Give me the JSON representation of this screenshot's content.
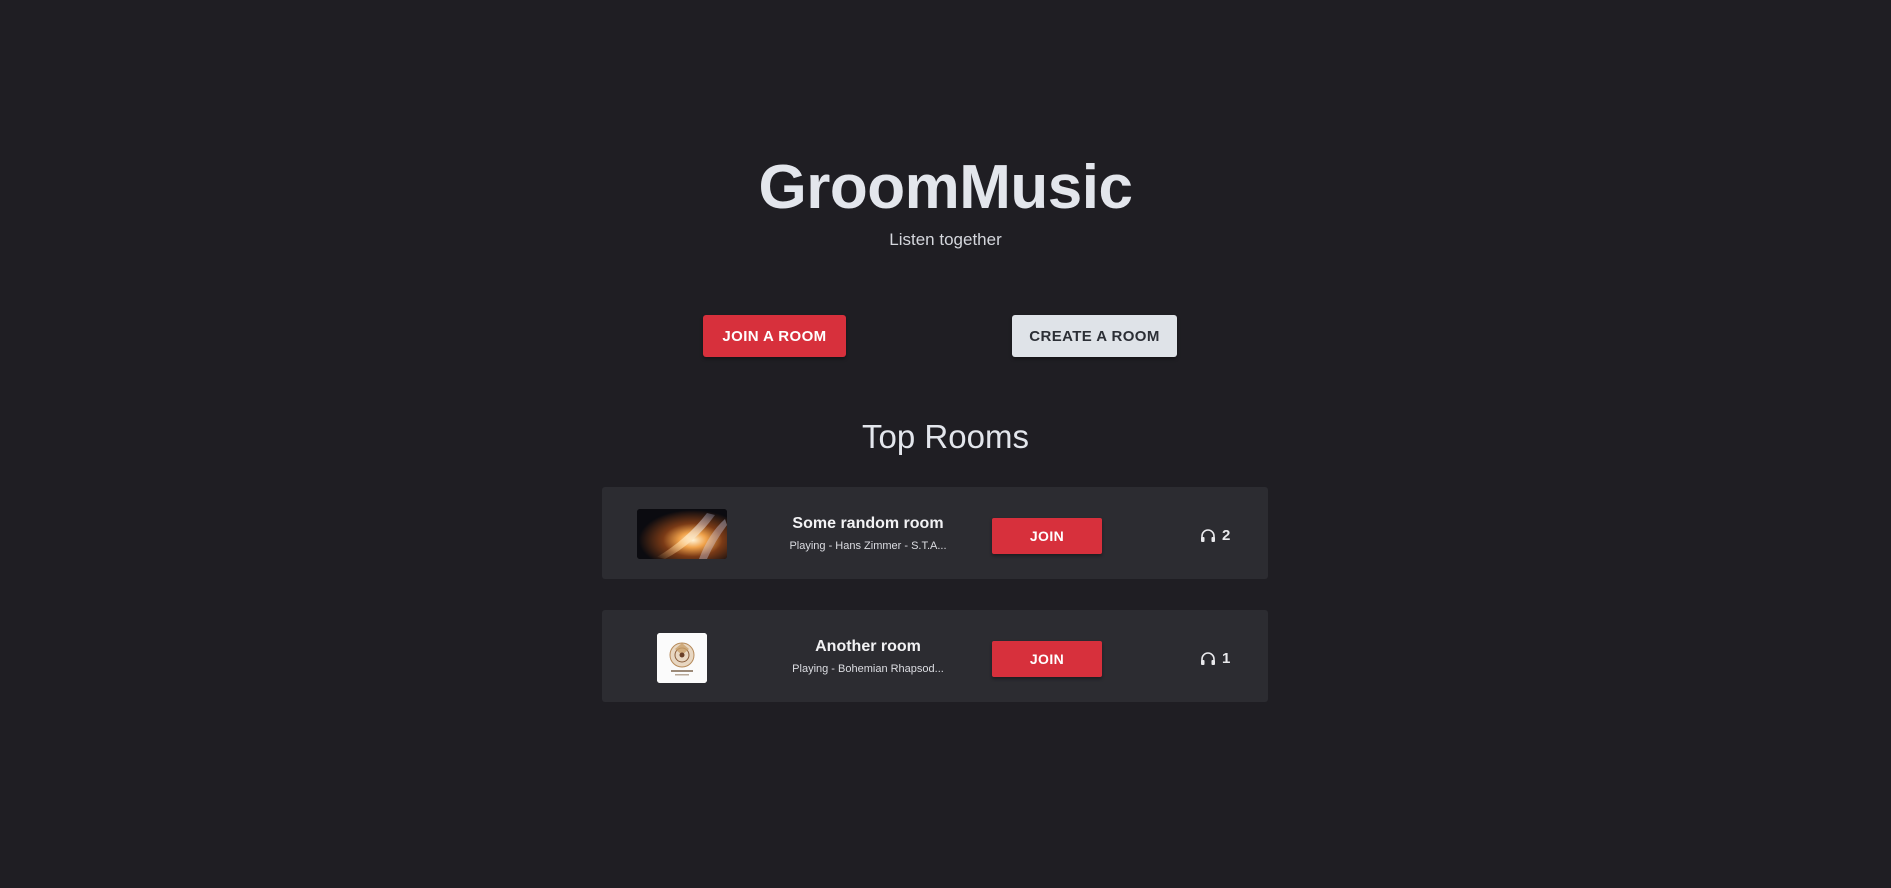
{
  "header": {
    "title": "GroomMusic",
    "tagline": "Listen together"
  },
  "actions": {
    "join_room_label": "JOIN A ROOM",
    "create_room_label": "CREATE A ROOM"
  },
  "top_rooms": {
    "heading": "Top Rooms",
    "rooms": [
      {
        "name": "Some random room",
        "playing": "Playing - Hans Zimmer - S.T.A...",
        "join_label": "JOIN",
        "listeners": "2",
        "thumbnail_icon": "album-art-cosmic"
      },
      {
        "name": "Another room",
        "playing": "Playing - Bohemian Rhapsod...",
        "join_label": "JOIN",
        "listeners": "1",
        "thumbnail_icon": "album-art-queen"
      }
    ]
  },
  "colors": {
    "background": "#1f1e23",
    "card": "#2c2c31",
    "accent": "#d7303c",
    "secondary_button": "#dfe3e8"
  }
}
